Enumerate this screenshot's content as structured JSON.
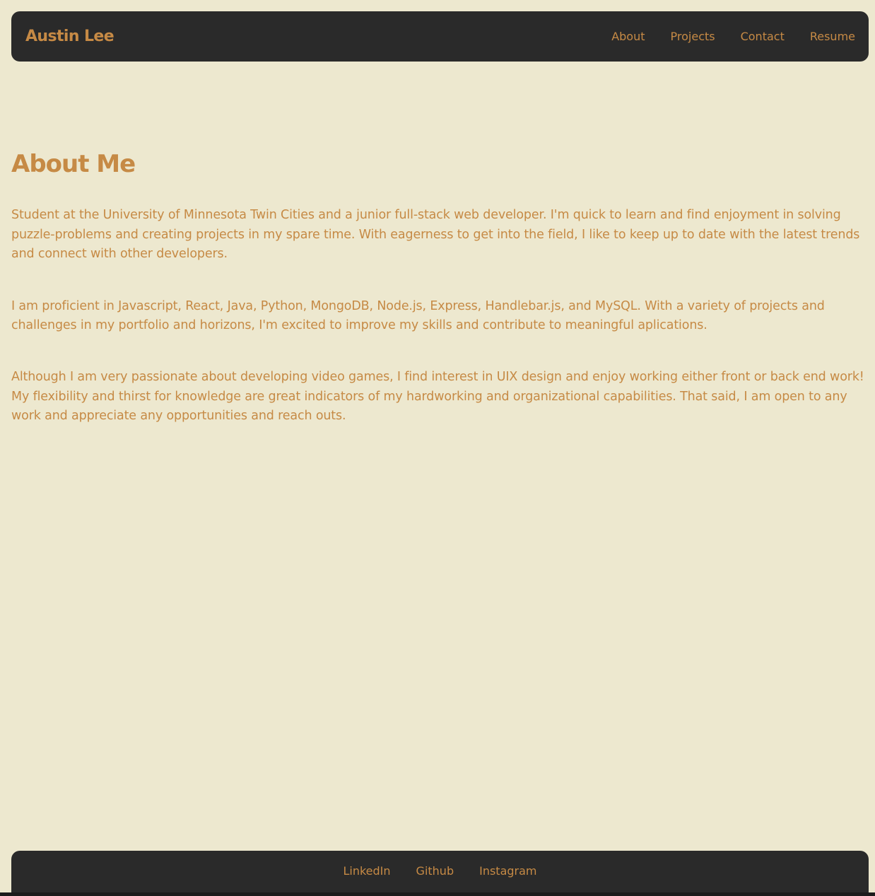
{
  "header": {
    "brand": "Austin Lee",
    "nav": [
      {
        "label": "About"
      },
      {
        "label": "Projects"
      },
      {
        "label": "Contact"
      },
      {
        "label": "Resume"
      }
    ]
  },
  "about": {
    "title": "About Me",
    "paragraphs": [
      "Student at the University of Minnesota Twin Cities and a junior full-stack web developer. I'm quick to learn and find enjoyment in solving puzzle-problems and creating projects in my spare time. With eagerness to get into the field, I like to keep up to date with the latest trends and connect with other developers.",
      "I am proficient in Javascript, React, Java, Python, MongoDB, Node.js, Express, Handlebar.js, and MySQL. With a variety of projects and challenges in my portfolio and horizons, I'm excited to improve my skills and contribute to meaningful aplications.",
      "Although I am very passionate about developing video games, I find interest in UIX design and enjoy working either front or back end work! My flexibility and thirst for knowledge are great indicators of my hardworking and organizational capabilities. That said, I am open to any work and appreciate any opportunities and reach outs."
    ]
  },
  "footer": {
    "links": [
      {
        "label": "LinkedIn"
      },
      {
        "label": "Github"
      },
      {
        "label": "Instagram"
      }
    ]
  },
  "colors": {
    "background": "#ede8cf",
    "bar": "#2a2a2a",
    "accent": "#c68a45"
  }
}
